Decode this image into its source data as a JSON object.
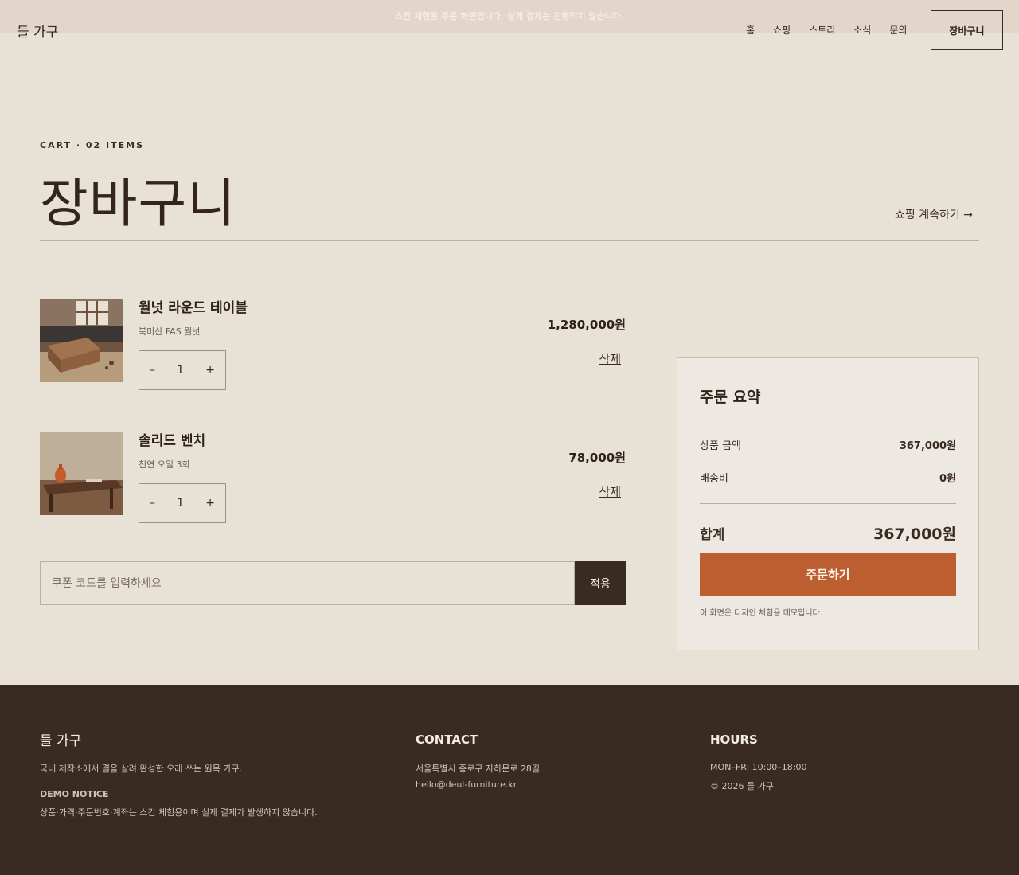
{
  "banner": {
    "text": "스킨 체험용 주문 화면입니다. 실제 결제는 진행되지 않습니다."
  },
  "header": {
    "logo": "들 가구",
    "nav": [
      "홈",
      "쇼핑",
      "스토리",
      "소식",
      "문의"
    ],
    "cart_label": "장바구니"
  },
  "page": {
    "eyebrow": "CART · 02 ITEMS",
    "title": "장바구니",
    "continue_link": "쇼핑 계속하기 →"
  },
  "cart": {
    "items": [
      {
        "name": "월넛 라운드 테이블",
        "option": "북미산 FAS 월넛",
        "quantity": "1",
        "price": "1,280,000원",
        "delete_label": "삭제",
        "minus": "–",
        "plus": "+"
      },
      {
        "name": "솔리드 벤치",
        "option": "천연 오일 3회",
        "quantity": "1",
        "price": "78,000원",
        "delete_label": "삭제",
        "minus": "–",
        "plus": "+"
      }
    ],
    "coupon_placeholder": "쿠폰 코드를 입력하세요",
    "apply_label": "적용"
  },
  "summary": {
    "title": "주문 요약",
    "subtotal_label": "상품 금액",
    "subtotal_value": "367,000원",
    "shipping_label": "배송비",
    "shipping_value": "0원",
    "total_label": "합계",
    "total_value": "367,000원",
    "order_label": "주문하기",
    "note": "이 화면은 디자인 체험용 데모입니다."
  },
  "footer": {
    "logo": "들 가구",
    "description": "국내 제작소에서 결을 살려 완성한 오래 쓰는 원목 가구.",
    "demo_title": "DEMO NOTICE",
    "demo_text": "상품·가격·주문번호·계좌는 스킨 체험용이며 실제 결제가 발생하지 않습니다.",
    "contact_title": "CONTACT",
    "address": "서울특별시 종로구 자하문로 28길",
    "email": "hello@deul-furniture.kr",
    "hours_title": "HOURS",
    "hours": "MON–FRI 10:00–18:00",
    "copyright": "© 2026 들 가구"
  },
  "colors": {
    "accent": "#bd5e30",
    "dark": "#3a2b22",
    "background": "#e8e1d6"
  }
}
